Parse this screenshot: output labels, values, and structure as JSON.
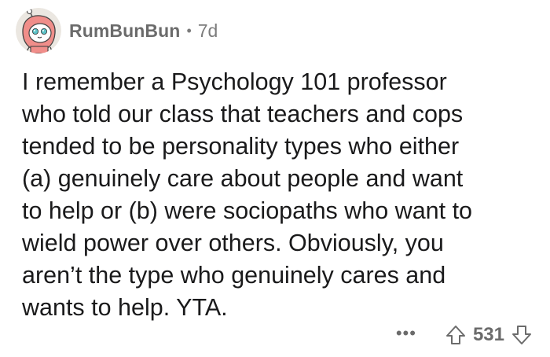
{
  "comment": {
    "author": "RumBunBun",
    "separator": "•",
    "age": "7d",
    "body": "I remember a Psychology 101 professor\nwho told our class that teachers and cops\ntended to be personality types who either\n(a) genuinely care about people and want\nto help or (b) were sociopaths who want to\nwield power over others. Obviously, you\naren’t the type who genuinely cares and\nwants to help. YTA.",
    "more_label": "•••",
    "score": "531"
  },
  "icons": {
    "avatar": "avatar-icon",
    "upvote": "upvote-arrow-icon",
    "downvote": "downvote-arrow-icon"
  },
  "colors": {
    "text": "#1a1a1b",
    "meta": "#7c7c7c",
    "avatar_bg": "#e9e5df",
    "avatar_hood": "#f08e8a"
  }
}
